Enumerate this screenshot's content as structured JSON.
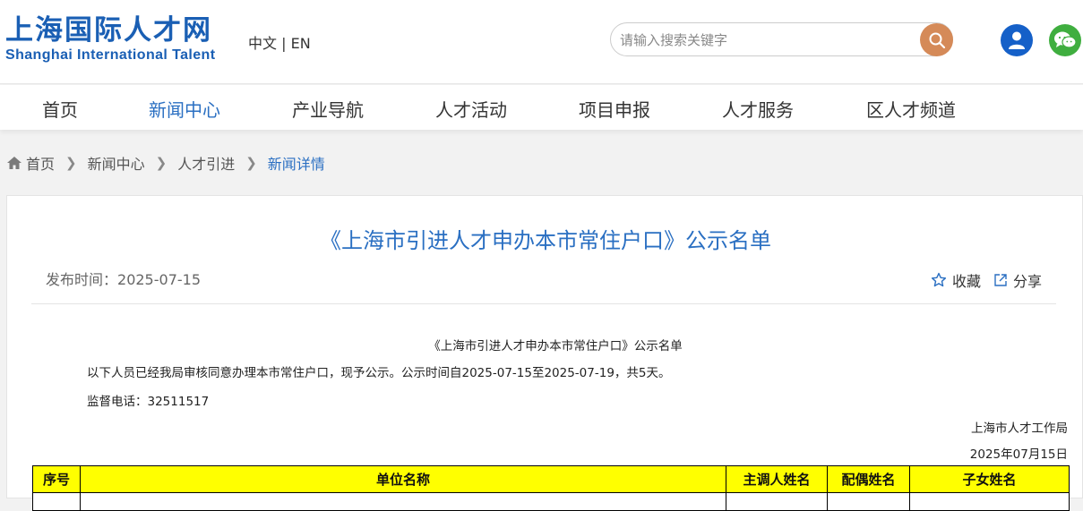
{
  "header": {
    "logo_cn": "上海国际人才网",
    "logo_en": "Shanghai International Talent",
    "lang_cn": "中文",
    "lang_sep": " | ",
    "lang_en": "EN",
    "search_placeholder": "请输入搜索关键字"
  },
  "nav": {
    "items": [
      "首页",
      "新闻中心",
      "产业导航",
      "人才活动",
      "项目申报",
      "人才服务",
      "区人才频道"
    ],
    "active_index": 1
  },
  "breadcrumb": {
    "items": [
      "首页",
      "新闻中心",
      "人才引进",
      "新闻详情"
    ]
  },
  "article": {
    "title": "《上海市引进人才申办本市常住户口》公示名单",
    "publish_label": "发布时间：",
    "publish_date": "2025-07-15",
    "favorite_label": "收藏",
    "share_label": "分享",
    "sub_title": "《上海市引进人才申办本市常住户口》公示名单",
    "paragraph": "以下人员已经我局审核同意办理本市常住户口，现予公示。公示时间自2025-07-15至2025-07-19，共5天。",
    "hotline_label": "监督电话：",
    "hotline": "32511517",
    "issuer": "上海市人才工作局",
    "issue_date": "2025年07月15日"
  },
  "table": {
    "headers": [
      "序号",
      "单位名称",
      "主调人姓名",
      "配偶姓名",
      "子女姓名"
    ]
  },
  "colors": {
    "brand_blue": "#1a5fb4",
    "link_blue": "#2a6fc2",
    "search_button": "#d58a58",
    "user_button": "#1560c8",
    "wechat_button": "#3fae3f",
    "table_header_bg": "#ffff00"
  },
  "icons": {
    "search": "search-icon",
    "user": "user-icon",
    "wechat": "wechat-icon",
    "home": "home-icon",
    "star": "star-icon",
    "share": "share-icon"
  }
}
